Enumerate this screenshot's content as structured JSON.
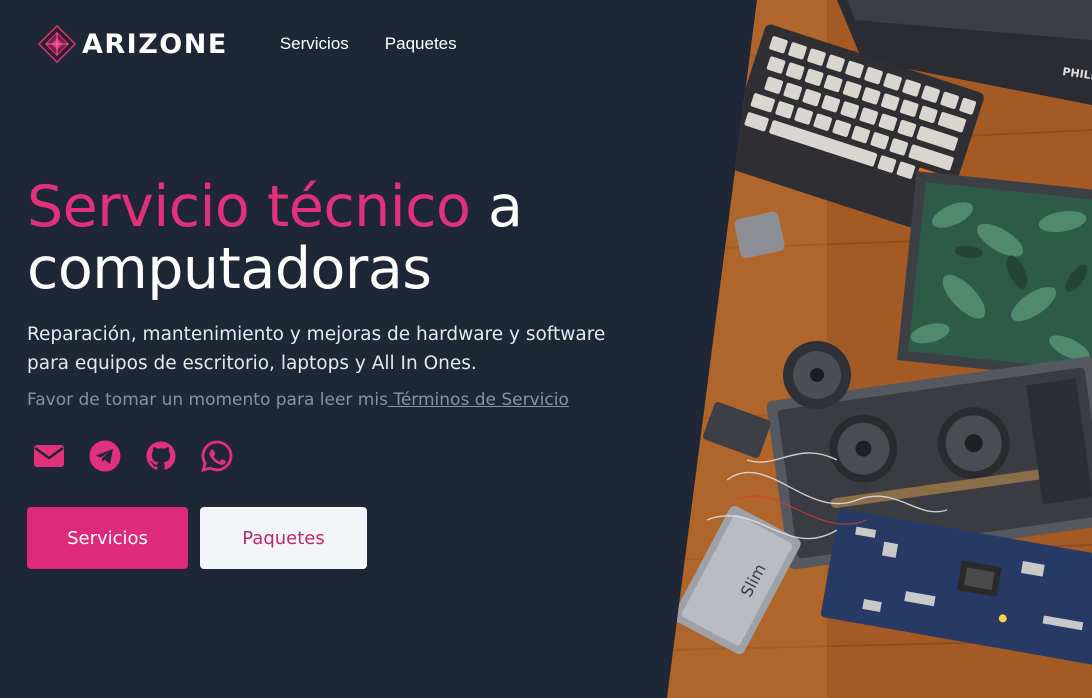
{
  "header": {
    "brand": "ARIZONE",
    "nav": [
      {
        "label": "Servicios"
      },
      {
        "label": "Paquetes"
      }
    ]
  },
  "hero": {
    "title_accent": "Servicio técnico",
    "title_rest_1": " a",
    "title_rest_2": "computadoras",
    "subtitle": "Reparación, mantenimiento y mejoras de hardware y software para equipos de escritorio, laptops y All In Ones.",
    "note_prefix": "Favor de tomar un momento para leer mis",
    "note_link": " Términos de Servicio",
    "social": [
      "envelope-icon",
      "telegram-icon",
      "github-icon",
      "whatsapp-icon"
    ],
    "buttons": {
      "primary": "Servicios",
      "secondary": "Paquetes"
    }
  },
  "photo": {
    "printed_text": "PHILI",
    "chip_text": "Slim"
  },
  "colors": {
    "background": "#1f2736",
    "accent": "#e1307c",
    "button_primary": "#dd2a7b",
    "button_secondary_bg": "#f4f5f8",
    "muted_text": "#8a91a0"
  }
}
